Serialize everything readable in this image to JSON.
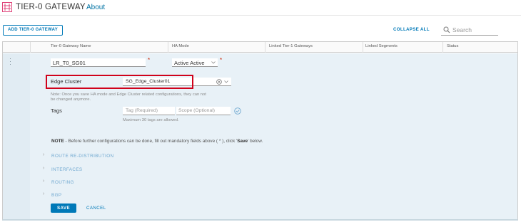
{
  "header": {
    "logo_icon": "gateway-icon",
    "title": "TIER-0 GATEWAY",
    "chevron": "⌄",
    "about_link": "About"
  },
  "toolbar": {
    "add_button": "ADD TIER-0 GATEWAY",
    "collapse_all": "COLLAPSE ALL",
    "search_placeholder": "Search"
  },
  "table": {
    "columns": [
      "Tier-0 Gateway Name",
      "HA Mode",
      "Linked Tier-1 Gateways",
      "Linked Segments",
      "Status"
    ]
  },
  "form": {
    "name_value": "LR_T0_SG01",
    "required_mark": "*",
    "ha_mode_value": "Active Active",
    "edge_cluster_label": "Edge Cluster",
    "edge_cluster_value": "SG_Edge_Cluster01",
    "edge_cluster_note_line1": "Note: Once you save HA mode and Edge Cluster related configurations, they can not",
    "edge_cluster_note_line2": "be changed anymore.",
    "tags_label": "Tags",
    "tag_placeholder": "Tag (Required)",
    "scope_placeholder": "Scope (Optional)",
    "tags_hint": "Maximum 30 tags are allowed.",
    "note_prefix": "NOTE",
    "note_text_1": " - Before further configurations can be done, fill out mandatory fields above ( * ), click '",
    "note_save": "Save",
    "note_text_2": "' below.",
    "sections": [
      "ROUTE RE-DISTRIBUTION",
      "INTERFACES",
      "ROUTING",
      "BGP"
    ],
    "save_button": "SAVE",
    "cancel_button": "CANCEL"
  },
  "colors": {
    "accent": "#0079b8",
    "highlight": "#d0021b",
    "edit_bg": "#e8f1f7"
  }
}
